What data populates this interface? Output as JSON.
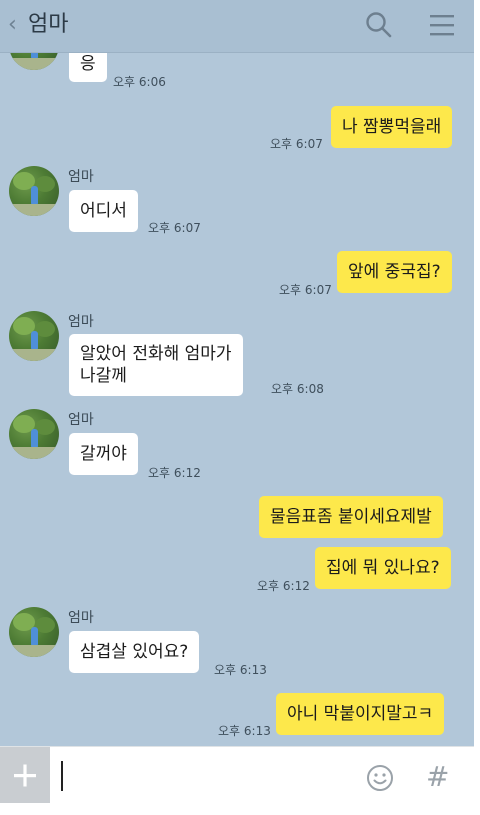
{
  "header": {
    "back_icon": "chevron-left-icon",
    "title": "엄마",
    "search_icon": "search-icon",
    "menu_icon": "hamburger-menu-icon"
  },
  "messages": [
    {
      "side": "in",
      "text": "응",
      "time": "오후 6:06"
    },
    {
      "side": "out",
      "text": "나 짬뽕먹을래",
      "time": "오후 6:07"
    },
    {
      "side": "in",
      "sender": "엄마",
      "text": "어디서",
      "time": "오후 6:07"
    },
    {
      "side": "out",
      "text": "앞에 중국집?",
      "time": "오후 6:07"
    },
    {
      "side": "in",
      "sender": "엄마",
      "text_line1": "알았어 전화해 엄마가",
      "text_line2": "나갈께",
      "time": "오후 6:08"
    },
    {
      "side": "in",
      "sender": "엄마",
      "text": "갈꺼야",
      "time": "오후 6:12"
    },
    {
      "side": "out",
      "text": "물음표좀 붙이세요제발"
    },
    {
      "side": "out",
      "text": "집에 뭐 있나요?",
      "time": "오후 6:12"
    },
    {
      "side": "in",
      "sender": "엄마",
      "text": "삼겹살 있어요?",
      "time": "오후 6:13"
    },
    {
      "side": "out",
      "text": "아니 막붙이지말고ㅋ",
      "time": "오후 6:13"
    }
  ],
  "input_bar": {
    "plus_icon": "plus-icon",
    "input_value": "",
    "emoji_icon": "smiley-icon",
    "hash_label": "#"
  },
  "colors": {
    "chat_background": "#b2c7d9",
    "outgoing_bubble": "#fde84b",
    "incoming_bubble": "#ffffff"
  }
}
